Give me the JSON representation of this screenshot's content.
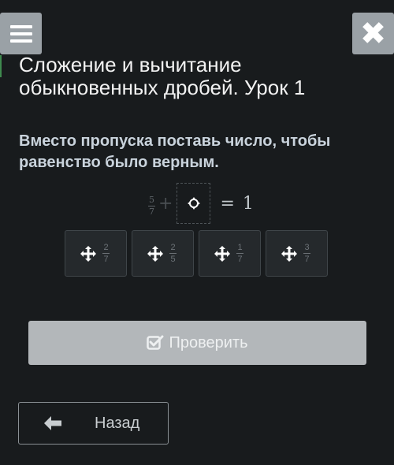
{
  "header": {
    "menu_icon": "hamburger-menu-icon",
    "close_icon": "close-icon",
    "title": "Сложение и вычитание обыкновенных дробей. Урок 1"
  },
  "task": {
    "instruction": "Вместо пропуска поставь число, чтобы равенство было верным.",
    "equation": {
      "left_fraction": {
        "numerator": "5",
        "denominator": "7"
      },
      "operator": "+",
      "equals": "=",
      "result": "1"
    },
    "options": [
      {
        "numerator": "2",
        "denominator": "7"
      },
      {
        "numerator": "2",
        "denominator": "5"
      },
      {
        "numerator": "1",
        "denominator": "7"
      },
      {
        "numerator": "3",
        "denominator": "7"
      }
    ]
  },
  "actions": {
    "check_label": "Проверить",
    "check_icon": "checkbox-check-icon",
    "back_label": "Назад",
    "back_icon": "arrow-left-icon",
    "drag_icon": "move-arrows-icon"
  },
  "colors": {
    "background": "#181b1d",
    "button_gray": "#9aa1a6",
    "check_button": "#b3b7ba"
  }
}
